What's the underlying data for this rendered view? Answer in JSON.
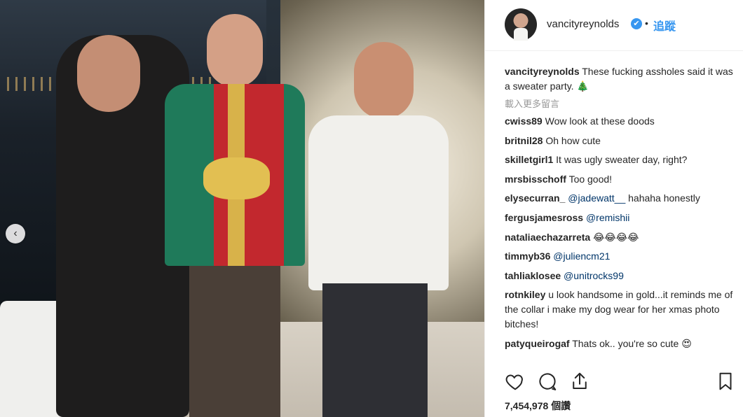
{
  "post": {
    "username": "vancityreynolds",
    "verified_glyph": "✔",
    "separator": "•",
    "follow_label": "追蹤",
    "caption": {
      "username": "vancityreynolds",
      "text": "These fucking assholes said it was a sweater party. 🎄"
    },
    "load_more_label": "載入更多留言",
    "likes_count": "7,454,978",
    "likes_unit": "個讚"
  },
  "comments": [
    {
      "username": "cwiss89",
      "text": "Wow look at these doods"
    },
    {
      "username": "britnil28",
      "text": "Oh how cute"
    },
    {
      "username": "skilletgirl1",
      "text": "It was ugly sweater day, right?"
    },
    {
      "username": "mrsbisschoff",
      "text": "Too good!"
    },
    {
      "username": "elysecurran_",
      "mention": "@jadewatt__",
      "text": "hahaha honestly"
    },
    {
      "username": "fergusjamesross",
      "mention": "@remishii",
      "text": ""
    },
    {
      "username": "nataliaechazarreta",
      "text": "😂😂😂😂"
    },
    {
      "username": "timmyb36",
      "mention": "@juliencm21",
      "text": ""
    },
    {
      "username": "tahliaklosee",
      "mention": "@unitrocks99",
      "text": ""
    },
    {
      "username": "rotnkiley",
      "text": "u look handsome in gold...it reminds me of the collar i make my dog wear for her xmas photo bitches!"
    },
    {
      "username": "patyqueirogaf",
      "text": "Thats ok.. you're so cute 😍"
    }
  ],
  "icons": {
    "like": "heart-icon",
    "comment": "comment-icon",
    "share": "share-icon",
    "save": "bookmark-icon",
    "carousel_prev": "chevron-left-icon"
  },
  "colors": {
    "link_blue": "#3897f0",
    "text": "#262626",
    "muted": "#999999"
  }
}
